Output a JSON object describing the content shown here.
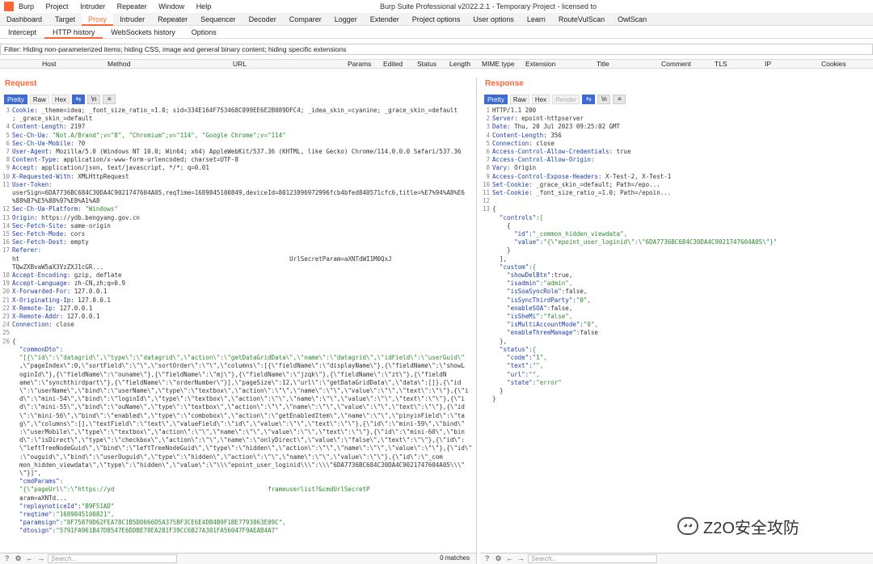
{
  "app": {
    "window_title": "Burp Suite Professional v2022.2.1 - Temporary Project - licensed to",
    "menu": [
      "Burp",
      "Project",
      "Intruder",
      "Repeater",
      "Window",
      "Help"
    ]
  },
  "main_tabs": [
    "Dashboard",
    "Target",
    "Proxy",
    "Intruder",
    "Repeater",
    "Sequencer",
    "Decoder",
    "Comparer",
    "Logger",
    "Extender",
    "Project options",
    "User options",
    "Learn",
    "RouteVulScan",
    "OwlScan"
  ],
  "main_tab_active": "Proxy",
  "sub_tabs": [
    "Intercept",
    "HTTP history",
    "WebSockets history",
    "Options"
  ],
  "sub_tab_active": "HTTP history",
  "filter_text": "Filter: Hiding non-parameterized items;  hiding CSS, image and general binary content;  hiding specific extensions",
  "columns": [
    "Host",
    "Method",
    "URL",
    "Params",
    "Edited",
    "Status",
    "Length",
    "MIME type",
    "Extension",
    "Title",
    "Comment",
    "TLS",
    "IP",
    "Cookies"
  ],
  "request": {
    "title": "Request",
    "tools": [
      "Pretty",
      "Raw",
      "Hex"
    ],
    "lines": [
      {
        "n": "3",
        "k": "Cookie: ",
        "v": "_theme=idea; _font_size_ratio_=1.0; sid=334E164F753468C899EE6E2B089DFC4; _idea_skin_=cyanine; _grace_skin_=default"
      },
      {
        "n": "",
        "k": "",
        "v": "; _grace_skin_=default"
      },
      {
        "n": "4",
        "k": "Content-Length: ",
        "v": "2197"
      },
      {
        "n": "5",
        "k": "Sec-Ch-Ua: ",
        "v": "\"Not.A/Brand\";v=\"8\", \"Chromium\";v=\"114\", \"Google Chrome\";v=\"114\""
      },
      {
        "n": "6",
        "k": "Sec-Ch-Ua-Mobile: ",
        "v": "?0"
      },
      {
        "n": "7",
        "k": "User-Agent: ",
        "v": "Mozilla/5.0 (Windows NT 10.0; Win64; x64) AppleWebKit/537.36 (KHTML, like Gecko) Chrome/114.0.0.0 Safari/537.36"
      },
      {
        "n": "8",
        "k": "Content-Type: ",
        "v": "application/x-www-form-urlencoded; charset=UTF-8"
      },
      {
        "n": "9",
        "k": "Accept: ",
        "v": "application/json, text/javascript, */*; q=0.01"
      },
      {
        "n": "10",
        "k": "X-Requested-With: ",
        "v": "XMLHttpRequest"
      },
      {
        "n": "11",
        "k": "User-Token:",
        "v": ""
      },
      {
        "n": "",
        "k": "",
        "v": "userSign=6DA7736BC684C30DA4C9021747604A05,reqTime=1689845100849,deviceId=80123896972996fcb4bfed840571cfc6,title=%E7%94%A8%E6"
      },
      {
        "n": "",
        "k": "",
        "v": "%88%B7%E5%88%97%E8%A1%A8"
      },
      {
        "n": "12",
        "k": "Sec-Ch-Ua-Platform: ",
        "v": "\"Windows\""
      },
      {
        "n": "13",
        "k": "Origin: ",
        "v": "https://ydb.bengyang.gov.cn"
      },
      {
        "n": "14",
        "k": "Sec-Fetch-Site: ",
        "v": "same-origin"
      },
      {
        "n": "15",
        "k": "Sec-Fetch-Mode: ",
        "v": "cors"
      },
      {
        "n": "16",
        "k": "Sec-Fetch-Dest: ",
        "v": "empty"
      },
      {
        "n": "17",
        "k": "Referer:",
        "v": ""
      },
      {
        "n": "",
        "k": "",
        "v": "ht                                                                          UrlSecretParam=aXNTdWI1M0QxJ"
      },
      {
        "n": "",
        "k": "",
        "v": "TQwZXBvaW5aX3VzZXJ1cGR..."
      },
      {
        "n": "18",
        "k": "Accept-Encoding: ",
        "v": "gzip, deflate"
      },
      {
        "n": "19",
        "k": "Accept-Language: ",
        "v": "zh-CN,zh;q=0.9"
      },
      {
        "n": "20",
        "k": "X-Forwarded-For: ",
        "v": "127.0.0.1"
      },
      {
        "n": "21",
        "k": "X-Originating-Ip: ",
        "v": "127.0.0.1"
      },
      {
        "n": "22",
        "k": "X-Remote-Ip: ",
        "v": "127.0.0.1"
      },
      {
        "n": "23",
        "k": "X-Remote-Addr: ",
        "v": "127.0.0.1"
      },
      {
        "n": "24",
        "k": "Connection: ",
        "v": "close"
      },
      {
        "n": "25",
        "k": "",
        "v": ""
      },
      {
        "n": "26",
        "k": "",
        "v": "{"
      },
      {
        "n": "",
        "k": "  \"commonDto\":",
        "v": ""
      },
      {
        "n": "",
        "k": "",
        "v": "  \"[{\\\"id\\\":\\\"datagrid\\\",\\\"type\\\":\\\"datagrid\\\",\\\"action\\\":\\\"getDataGridData\\\",\\\"name\\\":\\\"datagrid\\\",\\\"idField\\\":\\\"userGuid\\\""
      },
      {
        "n": "",
        "k": "",
        "v": "  ,\\\"pageIndex\\\":0,\\\"sortField\\\":\\\"\\\",\\\"sortOrder\\\":\\\"\\\",\\\"columns\\\":[{\\\"fieldName\\\":\\\"displayName\\\"},{\\\"fieldName\\\":\\\"showL"
      },
      {
        "n": "",
        "k": "",
        "v": "  oginId\\\"},{\\\"fieldName\\\":\\\"ouname\\\"},{\\\"fieldName\\\":\\\"mj\\\"},{\\\"fieldName\\\":\\\"jzqk\\\"},{\\\"fieldName\\\":\\\"zt\\\"},{\\\"fieldN"
      },
      {
        "n": "",
        "k": "",
        "v": "  ame\\\":\\\"synchthirdpart\\\"},{\\\"fieldName\\\":\\\"orderNumber\\\"}],\\\"pageSize\\\":12,\\\"url\\\":\\\"getDataGridData\\\",\\\"data\\\":[]},{\\\"id"
      },
      {
        "n": "",
        "k": "",
        "v": "  \\\":\\\"userName\\\",\\\"bind\\\":\\\"userName\\\",\\\"type\\\":\\\"textbox\\\",\\\"action\\\":\\\"\\\",\\\"name\\\":\\\"\\\",\\\"value\\\":\\\"\\\",\\\"text\\\":\\\"\\\"},{\\\"i"
      },
      {
        "n": "",
        "k": "",
        "v": "  d\\\":\\\"mini-54\\\",\\\"bind\\\":\\\"loginId\\\",\\\"type\\\":\\\"textbox\\\",\\\"action\\\":\\\"\\\",\\\"name\\\":\\\"\\\",\\\"value\\\":\\\"\\\",\\\"text\\\":\\\"\\\"},{\\\"i"
      },
      {
        "n": "",
        "k": "",
        "v": "  d\\\":\\\"mini-55\\\",\\\"bind\\\":\\\"ouName\\\",\\\"type\\\":\\\"textbox\\\",\\\"action\\\":\\\"\\\",\\\"name\\\":\\\"\\\",\\\"value\\\":\\\"\\\",\\\"text\\\":\\\"\\\"},{\\\"id"
      },
      {
        "n": "",
        "k": "",
        "v": "  \\\":\\\"mini-56\\\",\\\"bind\\\":\\\"enabled\\\",\\\"type\\\":\\\"combobox\\\",\\\"action\\\":\\\"getEnabledItem\\\",\\\"name\\\":\\\"\\\",\\\"pinyinField\\\":\\\"ta"
      },
      {
        "n": "",
        "k": "",
        "v": "  g\\\",\\\"columns\\\":[],\\\"textField\\\":\\\"text\\\",\\\"valueField\\\":\\\"id\\\",\\\"value\\\":\\\"\\\",\\\"text\\\":\\\"\\\"},{\\\"id\\\":\\\"mini-59\\\",\\\"bind\\\""
      },
      {
        "n": "",
        "k": "",
        "v": "  :\\\"userMobile\\\",\\\"type\\\":\\\"textbox\\\",\\\"action\\\":\\\"\\\",\\\"name\\\":\\\"\\\",\\\"value\\\":\\\"\\\",\\\"text\\\":\\\"\\\"},{\\\"id\\\":\\\"mini-60\\\",\\\"bin"
      },
      {
        "n": "",
        "k": "",
        "v": "  d\\\":\\\"isDirect\\\",\\\"type\\\":\\\"checkbox\\\",\\\"action\\\":\\\"\\\",\\\"name\\\":\\\"onlyDirect\\\",\\\"value\\\":\\\"false\\\",\\\"text\\\":\\\"\\\"},{\\\"id\\\":"
      },
      {
        "n": "",
        "k": "",
        "v": "  \\\"leftTreeNodeGuid\\\",\\\"bind\\\":\\\"leftTreeNodeGuid\\\",\\\"type\\\":\\\"hidden\\\",\\\"action\\\":\\\"\\\",\\\"name\\\":\\\"\\\",\\\"value\\\":\\\"\\\"},{\\\"id\\\""
      },
      {
        "n": "",
        "k": "",
        "v": "  :\\\"ouguid\\\",\\\"bind\\\":\\\"userOuguid\\\",\\\"type\\\":\\\"hidden\\\",\\\"action\\\":\\\"\\\",\\\"name\\\":\\\"\\\",\\\"value\\\":\\\"\\\"},{\\\"id\\\":\\\"_com"
      },
      {
        "n": "",
        "k": "",
        "v": "  mon_hidden_viewdata\\\",\\\"type\\\":\\\"hidden\\\",\\\"value\\\":\\\"\\\\\\\"epoint_user_loginid\\\\\\\":\\\\\\\"6DA7736BC684C30DA4C9021747604A05\\\\\\\""
      },
      {
        "n": "",
        "k": "",
        "v": "  \\\"}]\","
      },
      {
        "n": "",
        "k": "  \"cmdParams\":",
        "v": ""
      },
      {
        "n": "",
        "k": "",
        "v": "  \"{\\\"pageUrl\\\":\\\"https://yd                                          frameuserlist?&cmdUrlSecretP"
      },
      {
        "n": "",
        "k": "",
        "v": "  aram=aXNTd..."
      },
      {
        "n": "",
        "k": "  \"replaynoticeId\":",
        "v": "\"B9F51AD\""
      },
      {
        "n": "",
        "k": "  \"reqtime\":",
        "v": "\"1689845100821\","
      },
      {
        "n": "",
        "k": "  \"paramsign\":",
        "v": "\"8F75879D62FEA78C1B5DD066D5A375BF3CE6E4DB4B9F1BE7793863E09C\","
      },
      {
        "n": "",
        "k": "  \"dtosign\":",
        "v": "\"5791FA961B47D8547E6DDBE70EA281F39CC6B27A301FA56047F9AEAB4A7\""
      }
    ],
    "search_placeholder": "Search...",
    "matches": "0 matches"
  },
  "response": {
    "title": "Response",
    "tools": [
      "Pretty",
      "Raw",
      "Hex",
      "Render"
    ],
    "lines": [
      {
        "n": "1",
        "k": "",
        "v": "HTTP/1.1 200"
      },
      {
        "n": "2",
        "k": "Server: ",
        "v": "epoint-httpserver"
      },
      {
        "n": "3",
        "k": "Date: ",
        "v": "Thu, 20 Jul 2023 09:25:02 GMT"
      },
      {
        "n": "4",
        "k": "Content-Length: ",
        "v": "356"
      },
      {
        "n": "5",
        "k": "Connection: ",
        "v": "close"
      },
      {
        "n": "6",
        "k": "Access-Control-Allow-Credentials: ",
        "v": "true"
      },
      {
        "n": "7",
        "k": "Access-Control-Allow-Origin:",
        "v": ""
      },
      {
        "n": "8",
        "k": "Vary: ",
        "v": "Origin"
      },
      {
        "n": "9",
        "k": "Access-Control-Expose-Headers: ",
        "v": "X-Test-2, X-Test-1"
      },
      {
        "n": "10",
        "k": "Set-Cookie: ",
        "v": "_grace_skin_=default; Path=/epo..."
      },
      {
        "n": "11",
        "k": "Set-Cookie: ",
        "v": "_font_size_ratio_=1.0; Path=/epoin..."
      },
      {
        "n": "12",
        "k": "",
        "v": ""
      },
      {
        "n": "13",
        "k": "",
        "v": "{"
      },
      {
        "n": "",
        "k": "  \"controls\":",
        "v": "["
      },
      {
        "n": "",
        "k": "",
        "v": "    {"
      },
      {
        "n": "",
        "k": "      \"id\":",
        "v": "\"_common_hidden_viewdata\","
      },
      {
        "n": "",
        "k": "      \"value\":",
        "v": "\"{\\\"epoint_user_loginid\\\":\\\"6DA7736BC684C30DA4C9021747604A05\\\"}\""
      },
      {
        "n": "",
        "k": "",
        "v": "    }"
      },
      {
        "n": "",
        "k": "",
        "v": "  ],"
      },
      {
        "n": "",
        "k": "  \"custom\":",
        "v": "{"
      },
      {
        "n": "",
        "k": "    \"showDelBtn\":",
        "v": "true,"
      },
      {
        "n": "",
        "k": "    \"isadmin\":",
        "v": "\"admin\","
      },
      {
        "n": "",
        "k": "    \"isSoaSyncRole\":",
        "v": "false,"
      },
      {
        "n": "",
        "k": "    \"isSyncThirdParty\":",
        "v": "\"0\","
      },
      {
        "n": "",
        "k": "    \"enableSOA\":",
        "v": "false,"
      },
      {
        "n": "",
        "k": "    \"isSheMi\":",
        "v": "\"false\","
      },
      {
        "n": "",
        "k": "    \"isMultiAccountMode\":",
        "v": "\"0\","
      },
      {
        "n": "",
        "k": "    \"enableThreeManage\":",
        "v": "false"
      },
      {
        "n": "",
        "k": "",
        "v": "  },"
      },
      {
        "n": "",
        "k": "  \"status\":",
        "v": "{"
      },
      {
        "n": "",
        "k": "    \"code\":",
        "v": "\"1\","
      },
      {
        "n": "",
        "k": "    \"text\":",
        "v": "\"\","
      },
      {
        "n": "",
        "k": "    \"url\":",
        "v": "\"\","
      },
      {
        "n": "",
        "k": "    \"state\":",
        "v": "\"error\""
      },
      {
        "n": "",
        "k": "",
        "v": "  }"
      },
      {
        "n": "",
        "k": "",
        "v": "}"
      }
    ],
    "search_placeholder": "Search..."
  },
  "watermark": "Z2O安全攻防"
}
